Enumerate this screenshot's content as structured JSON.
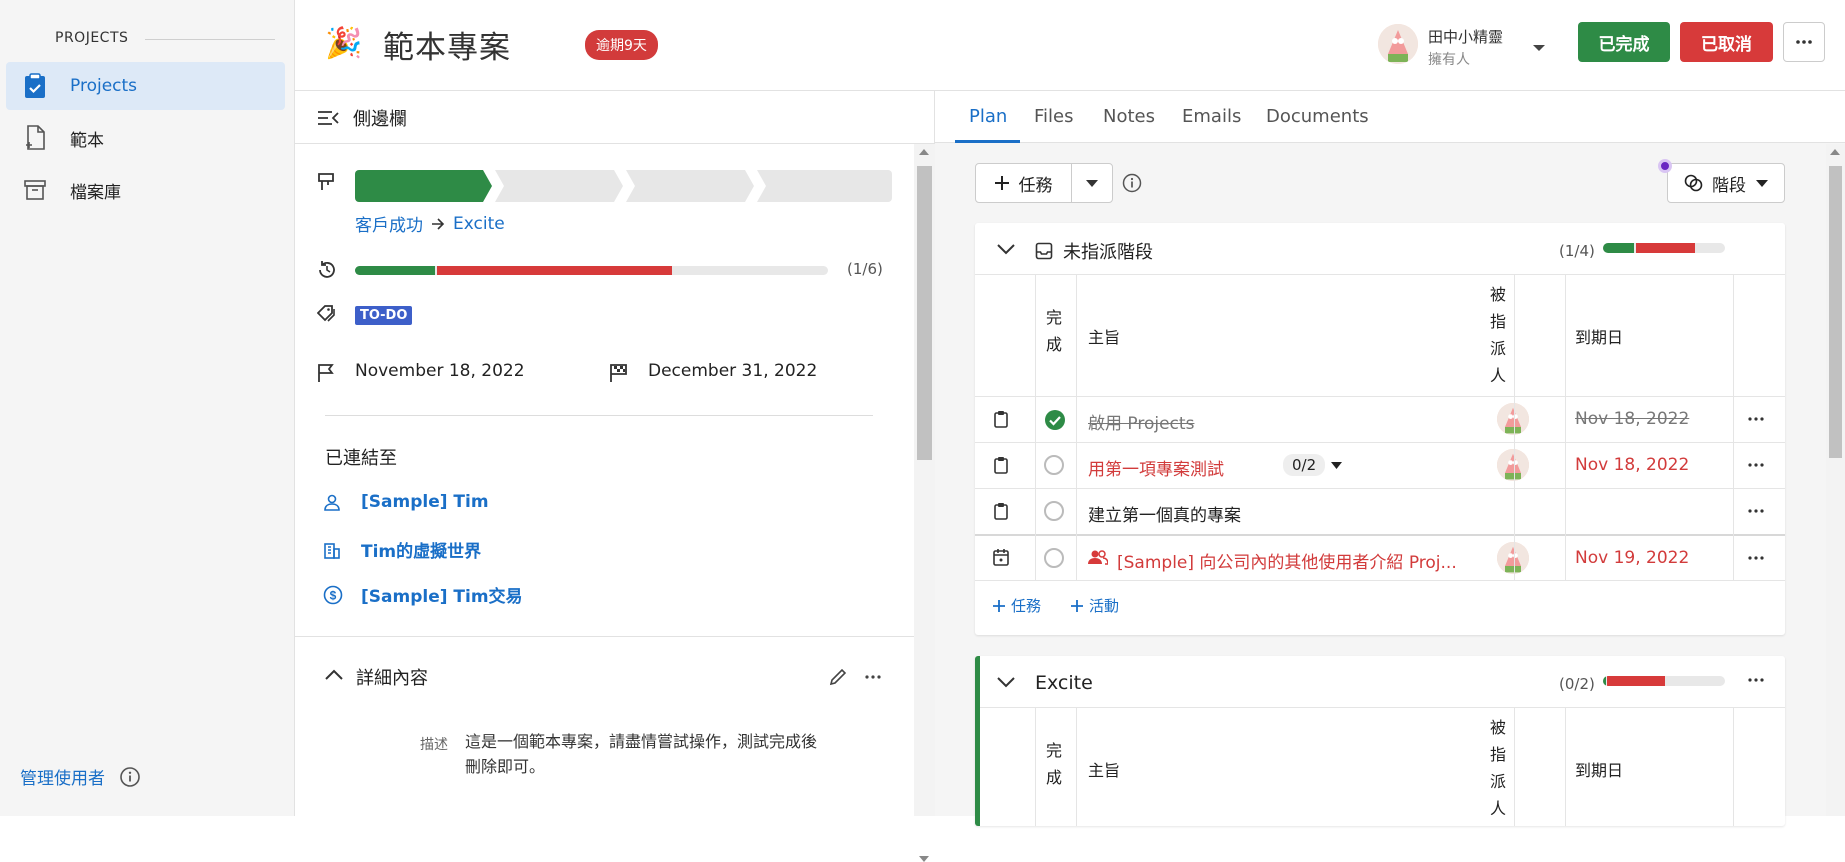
{
  "sidebar": {
    "section_title": "PROJECTS",
    "items": [
      {
        "label": "Projects",
        "icon": "clipboard-icon"
      },
      {
        "label": "範本",
        "icon": "file-plus-icon"
      },
      {
        "label": "檔案庫",
        "icon": "archive-icon"
      }
    ],
    "manage_users": "管理使用者"
  },
  "header": {
    "emoji": "🎉",
    "title": "範本專案",
    "overdue_badge": "逾期9天",
    "owner_name": "田中小精靈",
    "owner_role": "擁有人",
    "complete_label": "已完成",
    "cancel_label": "已取消",
    "colors": {
      "complete": "#2e8b46",
      "cancel": "#d73a3a"
    }
  },
  "details": {
    "sidebar_label": "側邊欄",
    "stages_active": 1,
    "stages_total": 4,
    "pipeline_from": "客戶成功",
    "pipeline_to": "Excite",
    "task_progress": "(1/6)",
    "task_progress_done_fraction": 0.17,
    "task_progress_overdue_fraction": 0.5,
    "tag": "TO-DO",
    "start_date": "November 18, 2022",
    "end_date": "December 31, 2022",
    "linked_heading": "已連結至",
    "linked": [
      {
        "label": "[Sample] Tim",
        "icon": "person-icon"
      },
      {
        "label": "Tim的虛擬世界",
        "icon": "building-icon"
      },
      {
        "label": "[Sample] Tim交易",
        "icon": "dollar-icon"
      }
    ],
    "detail_heading": "詳細內容",
    "description_label": "描述",
    "description_line1": "這是一個範本專案，請盡情嘗試操作，測試完成後",
    "description_line2": "刪除即可。"
  },
  "tabs": [
    "Plan",
    "Files",
    "Notes",
    "Emails",
    "Documents"
  ],
  "plan": {
    "add_task": "任務",
    "stage_button": "階段",
    "col_done": [
      "完",
      "成"
    ],
    "col_subject": "主旨",
    "col_assignee": [
      "被",
      "指",
      "派",
      "人"
    ],
    "col_due": "到期日",
    "unassigned": {
      "title": "未指派階段",
      "count": "(1/4)",
      "done_fraction": 0.25,
      "overdue_fraction": 0.5,
      "tasks": [
        {
          "subject": "啟用 Projects",
          "done": true,
          "due": "Nov 18, 2022",
          "style": "done",
          "has_avatar": true
        },
        {
          "subject": "用第一項專案測試",
          "subtasks": "0/2",
          "done": false,
          "due": "Nov 18, 2022",
          "style": "overdue",
          "has_avatar": true
        },
        {
          "subject": "建立第一個真的專案",
          "done": false,
          "due": "",
          "style": "normal",
          "has_avatar": false
        },
        {
          "subject": "[Sample] 向公司內的其他使用者介紹 Proj...",
          "done": false,
          "due": "Nov 19, 2022",
          "style": "overdue",
          "has_avatar": true
        }
      ],
      "add_task": "任務",
      "add_activity": "活動"
    },
    "excite": {
      "title": "Excite",
      "count": "(0/2)",
      "done_fraction": 0.02,
      "overdue_fraction": 0.48
    }
  }
}
